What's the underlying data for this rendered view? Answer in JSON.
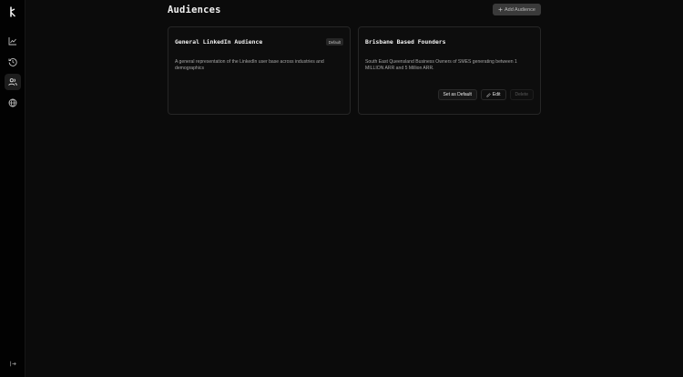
{
  "page": {
    "title": "Audiences"
  },
  "header": {
    "add_label": "Add Audience"
  },
  "sidebar": {
    "items": [
      {
        "name": "analytics",
        "icon": "line-chart-icon"
      },
      {
        "name": "history",
        "icon": "history-icon"
      },
      {
        "name": "audiences",
        "icon": "users-icon",
        "active": true
      },
      {
        "name": "explore",
        "icon": "globe-icon"
      }
    ]
  },
  "audiences": [
    {
      "title": "General LinkedIn Audience",
      "description": "A general representation of the LinkedIn user base across industries and demographics",
      "badge": "Default"
    },
    {
      "title": "Brisbane Based Founders",
      "description": "South East Queensland Business Owners of SMES generating between 1 MILLION ARR and 5 Million ARR.",
      "actions": {
        "set_default": "Set as Default",
        "edit": "Edit",
        "delete": "Delete"
      }
    }
  ],
  "colors": {
    "background": "#0b0b0b",
    "sidebar": "#020202",
    "card_border": "#262626",
    "muted_text": "#a6a6a6"
  }
}
